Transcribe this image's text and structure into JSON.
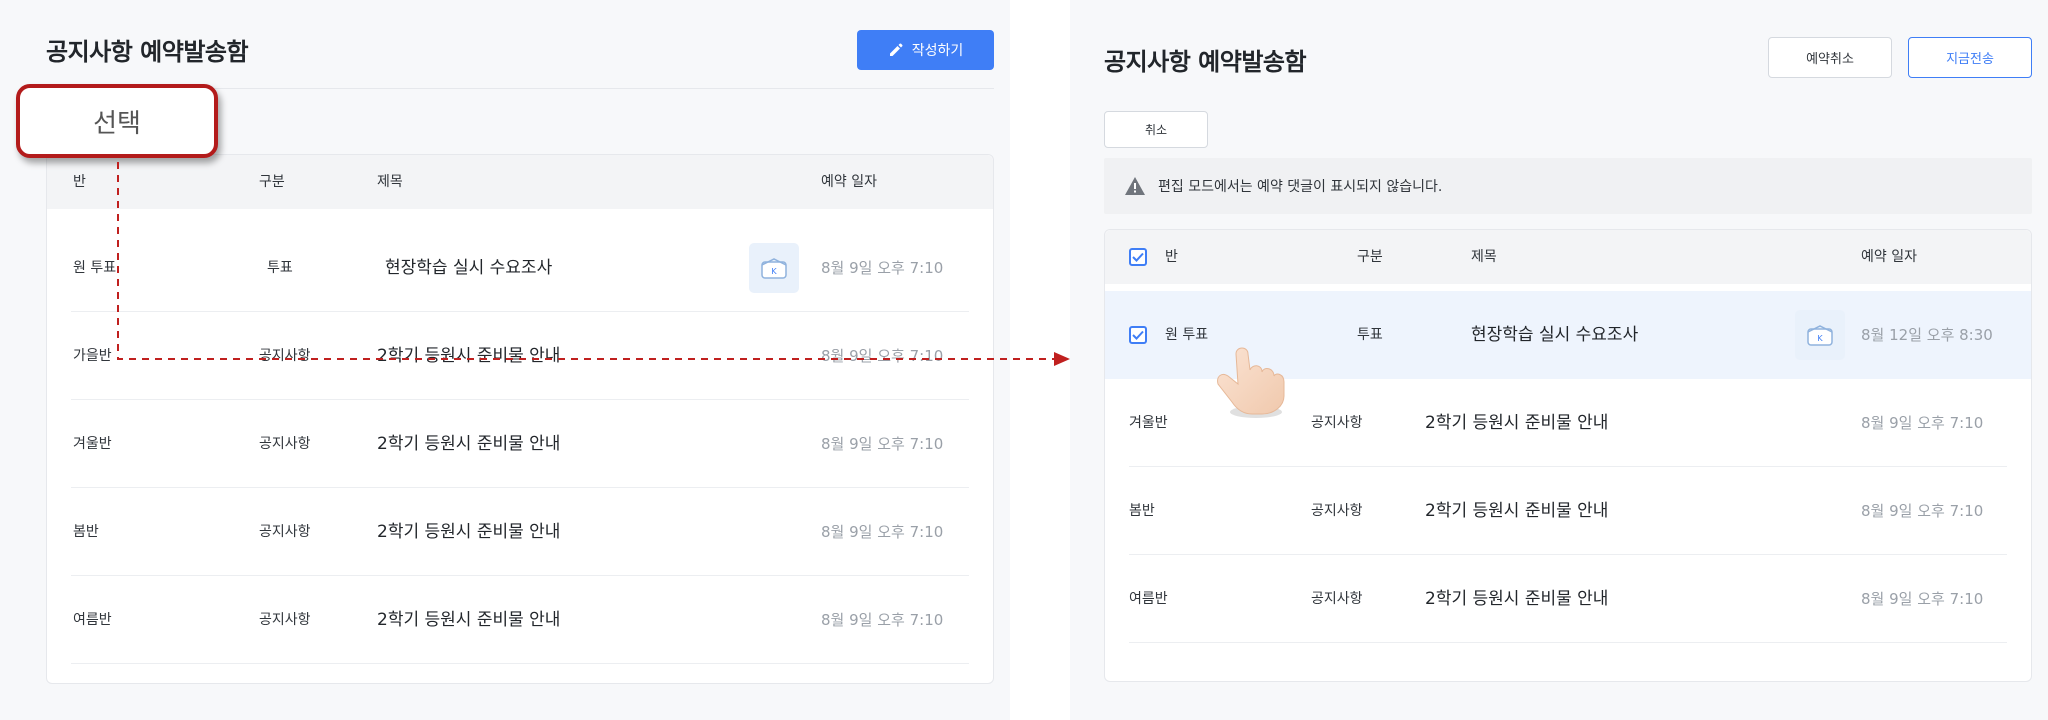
{
  "left": {
    "title": "공지사항 예약발송함",
    "write_button": "작성하기",
    "callout": "선택",
    "headers": {
      "class": "반",
      "type": "구분",
      "subject": "제목",
      "date": "예약 일자"
    },
    "rows": [
      {
        "class": "원 투표",
        "type": "투표",
        "title": "현장학습 실시 수요조사",
        "date": "8월 9일 오후 7:10"
      },
      {
        "class": "가을반",
        "type": "공지사항",
        "title": "2학기 등원시 준비물 안내",
        "date": "8월 9일 오후 7:10"
      },
      {
        "class": "겨울반",
        "type": "공지사항",
        "title": "2학기 등원시 준비물 안내",
        "date": "8월 9일 오후 7:10"
      },
      {
        "class": "봄반",
        "type": "공지사항",
        "title": "2학기 등원시 준비물 안내",
        "date": "8월 9일 오후 7:10"
      },
      {
        "class": "여름반",
        "type": "공지사항",
        "title": "2학기 등원시 준비물 안내",
        "date": "8월 9일 오후 7:10"
      }
    ]
  },
  "right": {
    "title": "공지사항 예약발송함",
    "cancel_reservation_button": "예약취소",
    "send_now_button": "지금전송",
    "cancel_button": "취소",
    "notice": "편집 모드에서는 예약 댓글이 표시되지 않습니다.",
    "headers": {
      "class": "반",
      "type": "구분",
      "subject": "제목",
      "date": "예약 일자"
    },
    "rows": [
      {
        "class": "원 투표",
        "type": "투표",
        "title": "현장학습 실시 수요조사",
        "date": "8월 12일 오후 8:30"
      },
      {
        "class": "겨울반",
        "type": "공지사항",
        "title": "2학기 등원시 준비물 안내",
        "date": "8월 9일 오후 7:10"
      },
      {
        "class": "봄반",
        "type": "공지사항",
        "title": "2학기 등원시 준비물 안내",
        "date": "8월 9일 오후 7:10"
      },
      {
        "class": "여름반",
        "type": "공지사항",
        "title": "2학기 등원시 준비물 안내",
        "date": "8월 9일 오후 7:10"
      }
    ]
  },
  "colors": {
    "accent": "#3f7ef6",
    "callout_border": "#b31b1b",
    "arrow": "#c0201f",
    "selected_row": "#eef4fd"
  },
  "icons": {
    "write": "pencil-icon",
    "warning": "warning-triangle-icon",
    "kakao": "kakao-box-icon",
    "pointer": "hand-pointer-icon"
  }
}
